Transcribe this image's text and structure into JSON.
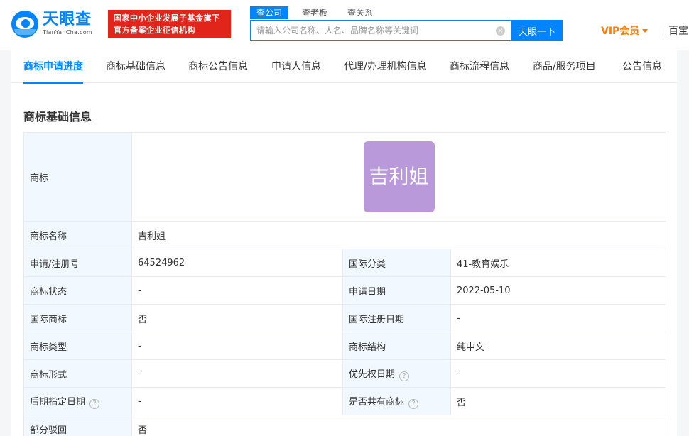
{
  "header": {
    "logo_cn": "天眼查",
    "logo_en": "TianYanCha.com",
    "badge_line1": "国家中小企业发展子基金旗下",
    "badge_line2": "官方备案企业征信机构",
    "search_tabs": [
      "查公司",
      "查老板",
      "查关系"
    ],
    "search_placeholder": "请输入公司名称、人名、品牌名称等关键词",
    "clear_icon": "×",
    "search_button": "天眼一下",
    "vip_label": "VIP会员",
    "baobao": "百宝"
  },
  "nav": {
    "tabs": [
      "商标申请进度",
      "商标基础信息",
      "商标公告信息",
      "申请人信息",
      "代理/办理机构信息",
      "商标流程信息",
      "商品/服务项目",
      "公告信息"
    ]
  },
  "section": {
    "title": "商标基础信息"
  },
  "info": {
    "logo_label": "商标",
    "logo_text": "吉利姐",
    "name_label": "商标名称",
    "name_value": "吉利姐",
    "reg_no_label": "申请/注册号",
    "reg_no_value": "64524962",
    "intl_class_label": "国际分类",
    "intl_class_value": "41-教育娱乐",
    "status_label": "商标状态",
    "status_value": "-",
    "apply_date_label": "申请日期",
    "apply_date_value": "2022-05-10",
    "intl_tm_label": "国际商标",
    "intl_tm_value": "否",
    "intl_reg_date_label": "国际注册日期",
    "intl_reg_date_value": "-",
    "type_label": "商标类型",
    "type_value": "-",
    "structure_label": "商标结构",
    "structure_value": "纯中文",
    "form_label": "商标形式",
    "form_value": "-",
    "priority_date_label": "优先权日期",
    "priority_date_value": "-",
    "later_date_label": "后期指定日期",
    "later_date_value": "-",
    "shared_label": "是否共有商标",
    "shared_value": "否",
    "partial_reject_label": "部分驳回",
    "partial_reject_value": "否",
    "help_icon": "?"
  },
  "colors": {
    "brand_blue": "#0084ff",
    "badge_red": "#e1251b",
    "vip_orange": "#ff7d00",
    "label_bg": "#f2f8ff",
    "tm_image_bg": "#b999d9"
  }
}
